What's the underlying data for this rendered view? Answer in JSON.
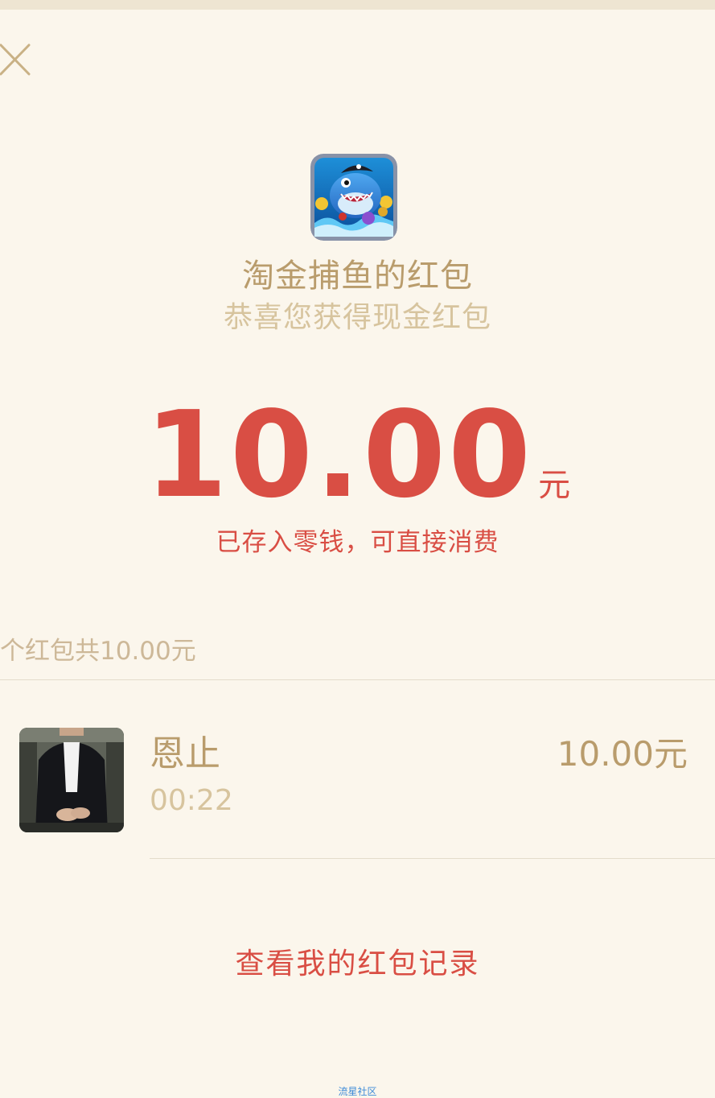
{
  "header": {
    "close_icon": "close-icon"
  },
  "app": {
    "icon": "shark-pirate-game-icon",
    "title": "淘金捕鱼的红包",
    "subtitle": "恭喜您获得现金红包"
  },
  "amount": {
    "value": "10.00",
    "unit": "元",
    "notice": "已存入零钱，可直接消费"
  },
  "summary": {
    "text": "个红包共10.00元"
  },
  "records": [
    {
      "name": "恩止",
      "time": "00:22",
      "amount": "10.00元",
      "avatar": "user-avatar"
    }
  ],
  "footer": {
    "view_records_label": "查看我的红包记录",
    "watermark": "流星社区"
  },
  "colors": {
    "background": "#FBF6EC",
    "gold_text": "#B99C6C",
    "light_gold_text": "#D7C49E",
    "red_accent": "#D94E44",
    "watermark": "#3D8BD8"
  }
}
